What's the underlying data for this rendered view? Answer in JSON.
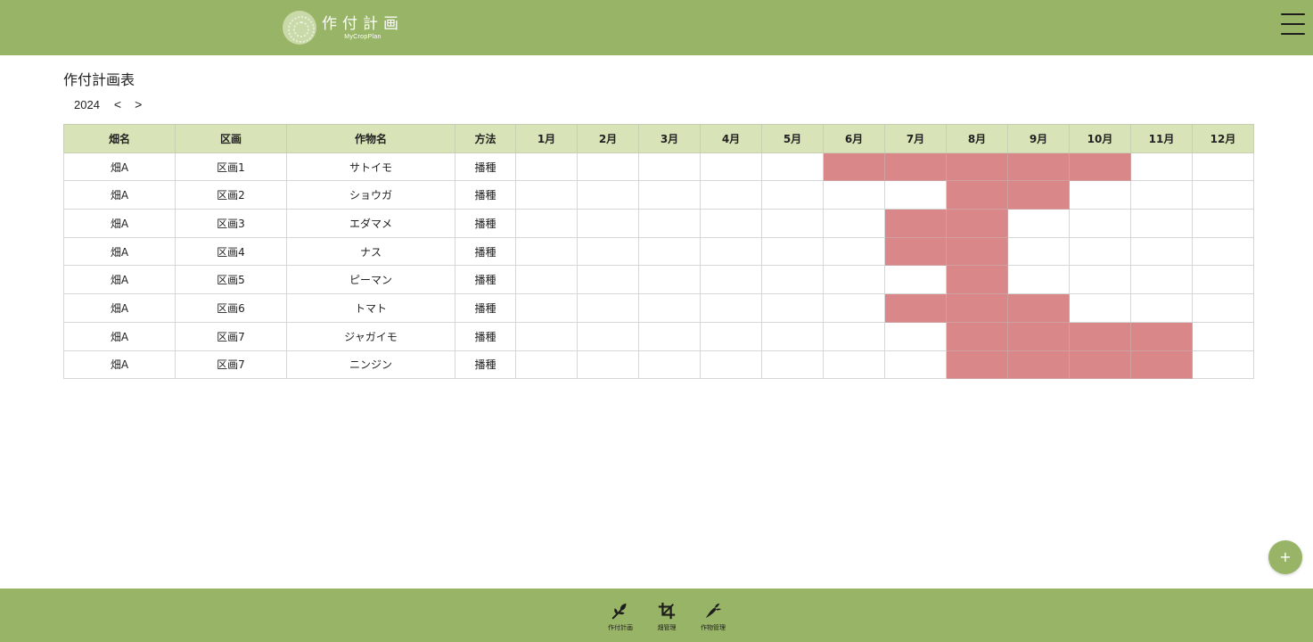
{
  "header": {
    "logo_title": "作付計画",
    "logo_subtitle": "MyCropPlan"
  },
  "main": {
    "title": "作付計画表",
    "year": "2024",
    "prev_label": "<",
    "next_label": ">"
  },
  "table": {
    "columns": [
      "畑名",
      "区画",
      "作物名",
      "方法",
      "1月",
      "2月",
      "3月",
      "4月",
      "5月",
      "6月",
      "7月",
      "8月",
      "9月",
      "10月",
      "11月",
      "12月"
    ],
    "rows": [
      {
        "field": "畑A",
        "plot": "区画1",
        "crop": "サトイモ",
        "method": "播種",
        "months": [
          6,
          7,
          8,
          9,
          10
        ]
      },
      {
        "field": "畑A",
        "plot": "区画2",
        "crop": "ショウガ",
        "method": "播種",
        "months": [
          8,
          9
        ]
      },
      {
        "field": "畑A",
        "plot": "区画3",
        "crop": "エダマメ",
        "method": "播種",
        "months": [
          7,
          8
        ]
      },
      {
        "field": "畑A",
        "plot": "区画4",
        "crop": "ナス",
        "method": "播種",
        "months": [
          7,
          8
        ]
      },
      {
        "field": "畑A",
        "plot": "区画5",
        "crop": "ピーマン",
        "method": "播種",
        "months": [
          8
        ]
      },
      {
        "field": "畑A",
        "plot": "区画6",
        "crop": "トマト",
        "method": "播種",
        "months": [
          7,
          8,
          9
        ]
      },
      {
        "field": "畑A",
        "plot": "区画7",
        "crop": "ジャガイモ",
        "method": "播種",
        "months": [
          8,
          9,
          10,
          11
        ]
      },
      {
        "field": "畑A",
        "plot": "区画7",
        "crop": "ニンジン",
        "method": "播種",
        "months": [
          8,
          9,
          10,
          11
        ]
      }
    ]
  },
  "fab": {
    "label": "+"
  },
  "footer": {
    "items": [
      {
        "label": "作付計画",
        "icon": "seedling-icon"
      },
      {
        "label": "畑管理",
        "icon": "crop-frame-icon"
      },
      {
        "label": "作物管理",
        "icon": "carrot-icon"
      }
    ]
  },
  "colors": {
    "brand": "#98b466",
    "table_header": "#d8e4b7",
    "planned": "#d98788"
  }
}
